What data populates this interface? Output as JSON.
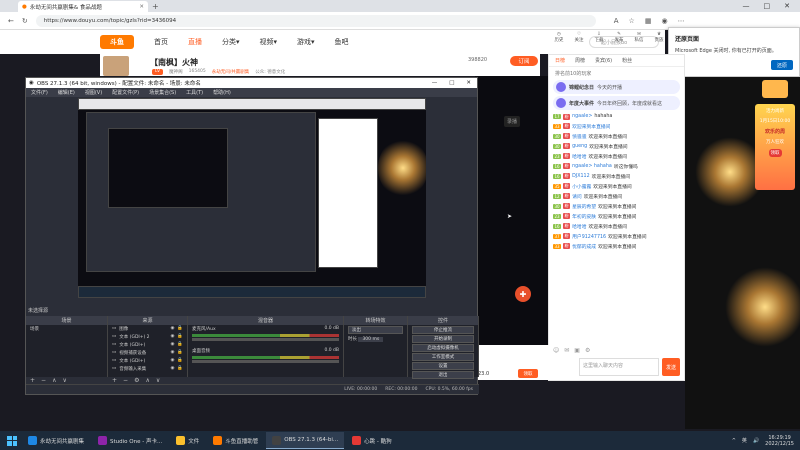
{
  "browser": {
    "tab_title": "永劫无间共赢剧集& 食品战题",
    "url": "https://www.douyu.com/topic/gzls?rid=3436094",
    "window_controls": [
      "—",
      "□",
      "✕"
    ]
  },
  "site": {
    "logo": "斗鱼",
    "nav": [
      "首页",
      "直播",
      "分类▾",
      "视频▾",
      "游戏▾",
      "鱼吧"
    ],
    "search_placeholder": "一起小屁孩bo",
    "top_icons": [
      "历史",
      "关注",
      "下载",
      "发布",
      "私信",
      "贵族"
    ]
  },
  "stream": {
    "streamer": "【南枫】火神",
    "badge": "LV",
    "tags": [
      "魔神阁",
      "165405",
      "永劫无间/共赢剧集",
      "公众: 德意文化"
    ],
    "follow_count": "398820",
    "subscribe": "订阅",
    "live_label": "录播"
  },
  "edge_popup": {
    "title": "还原页面",
    "body": "Microsoft Edge 关闭时, 你有已打开的页面。",
    "button": "还原"
  },
  "chat": {
    "tabs": [
      "日榜",
      "周榜",
      "贵宾(6)",
      "粉丝"
    ],
    "tab_active": 0,
    "rank_line": "排名前10的玩家",
    "notices": [
      {
        "label": "锦鲤纪念日",
        "text": "今天的开播"
      },
      {
        "label": "年度大事件",
        "text": "今日年终回顾，年度成就看这"
      }
    ],
    "messages": [
      {
        "lv": "17",
        "nick": "ngaale>",
        "text": "hahaha"
      },
      {
        "lv": "33",
        "nick": "欢迎来到本直播间",
        "text": ""
      },
      {
        "lv": "30",
        "nick": "愤骚骚",
        "text": "欢迎来到本直播间"
      },
      {
        "lv": "30",
        "nick": "gueng",
        "text": "欢迎来到本直播间"
      },
      {
        "lv": "23",
        "nick": "哈哈哈",
        "text": "欢迎来到本直播间"
      },
      {
        "lv": "16",
        "nick": "ngaale> hahaha",
        "text": "听这你懂吗"
      },
      {
        "lv": "16",
        "nick": "DJX112",
        "text": "欢迎来到本直播间"
      },
      {
        "lv": "35",
        "nick": "小小露露",
        "text": "欢迎来到本直播间"
      },
      {
        "lv": "12",
        "nick": "请问",
        "text": "欢迎来到本直播间"
      },
      {
        "lv": "30",
        "nick": "星辰的希望",
        "text": "欢迎来到本直播间"
      },
      {
        "lv": "23",
        "nick": "年初的皮肤",
        "text": "欢迎来到本直播间"
      },
      {
        "lv": "16",
        "nick": "哈哈哈",
        "text": "欢迎来到本直播间"
      },
      {
        "lv": "37",
        "nick": "用户91247716",
        "text": "欢迎来到本直播间"
      },
      {
        "lv": "33",
        "nick": "忧郁的成成",
        "text": "欢迎来到本直播间"
      }
    ],
    "input_placeholder": "这里输入聊天内容",
    "send": "发送"
  },
  "gift": {
    "count": "23.0",
    "button": "领取"
  },
  "side_ad": {
    "lines": [
      "活力尚新",
      "1月15日10:00",
      "欢乐的周",
      "万人狂欢",
      "领取"
    ]
  },
  "obs": {
    "title": "OBS 27.1.3 (64 bit, windows) - 配置文件: 未命名 - 场景: 未命名",
    "menu": [
      "文件(F)",
      "编辑(E)",
      "视图(V)",
      "配置文件(P)",
      "场景集合(S)",
      "工具(T)",
      "帮助(H)"
    ],
    "scene_label": "未选择源",
    "dock_titles": [
      "场景",
      "来源",
      "混音器",
      "转场特效",
      "控件"
    ],
    "scenes": [
      "场景"
    ],
    "sources": [
      "图像",
      "文本 (GDI+) 2",
      "文本 (GDI+)",
      "视频捕获设备",
      "文本 (GDI+)",
      "音频输入采集"
    ],
    "mixer": [
      {
        "name": "麦克风/Aux",
        "db": "0.0 dB"
      },
      {
        "name": "桌面音频",
        "db": "0.0 dB"
      }
    ],
    "transition": {
      "type": "淡出",
      "duration_label": "时长",
      "duration": "300 ms"
    },
    "controls": [
      "停止推流",
      "开始录制",
      "启动虚拟摄像机",
      "工作室模式",
      "设置",
      "退出"
    ],
    "status": [
      "LIVE: 00:00:00",
      "REC: 00:00:00",
      "CPU: 0.5%, 60.00 fps"
    ]
  },
  "taskbar": {
    "items": [
      "永劫无间共赢剧集",
      "Studio One - 声卡...",
      "文件",
      "斗鱼直播助管",
      "OBS 27.1.3 (64-bi...",
      "心跳 - 酷狗"
    ],
    "active_index": 4,
    "tray": [
      "^",
      "英"
    ],
    "time": "16:29:19",
    "date": "2022/12/15"
  },
  "colors": {
    "accent": "#ff5d23",
    "edge_blue": "#0067c0",
    "obs_bg": "#2b2e38"
  }
}
